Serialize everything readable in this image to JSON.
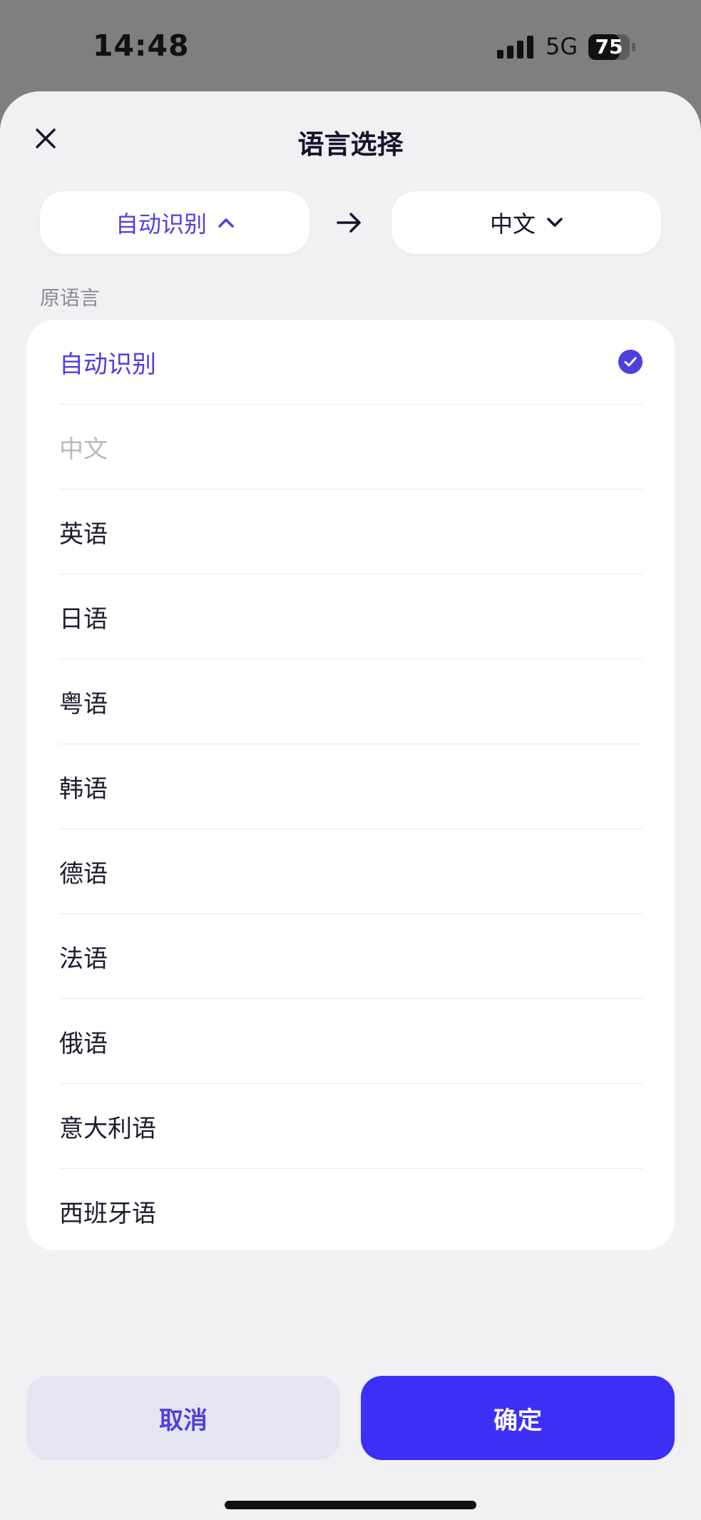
{
  "status_bar": {
    "time": "14:48",
    "network": "5G",
    "battery": "75"
  },
  "sheet": {
    "title": "语言选择"
  },
  "selector": {
    "source_label": "自动识别",
    "target_label": "中文"
  },
  "section_label": "原语言",
  "languages": [
    {
      "label": "自动识别",
      "state": "selected"
    },
    {
      "label": "中文",
      "state": "disabled"
    },
    {
      "label": "英语",
      "state": "normal"
    },
    {
      "label": "日语",
      "state": "normal"
    },
    {
      "label": "粤语",
      "state": "normal"
    },
    {
      "label": "韩语",
      "state": "normal"
    },
    {
      "label": "德语",
      "state": "normal"
    },
    {
      "label": "法语",
      "state": "normal"
    },
    {
      "label": "俄语",
      "state": "normal"
    },
    {
      "label": "意大利语",
      "state": "normal"
    },
    {
      "label": "西班牙语",
      "state": "normal"
    }
  ],
  "buttons": {
    "cancel": "取消",
    "confirm": "确定"
  },
  "colors": {
    "accent": "#4e3fe0",
    "primary_button": "#3c2ff7",
    "secondary_button": "#e6e5f4",
    "sheet_background": "#f1f1f4"
  },
  "icons": {
    "close": "close-icon",
    "chevron_up": "chevron-up-icon",
    "chevron_down": "chevron-down-icon",
    "arrow": "arrow-right-icon",
    "check": "check-circle-icon"
  }
}
